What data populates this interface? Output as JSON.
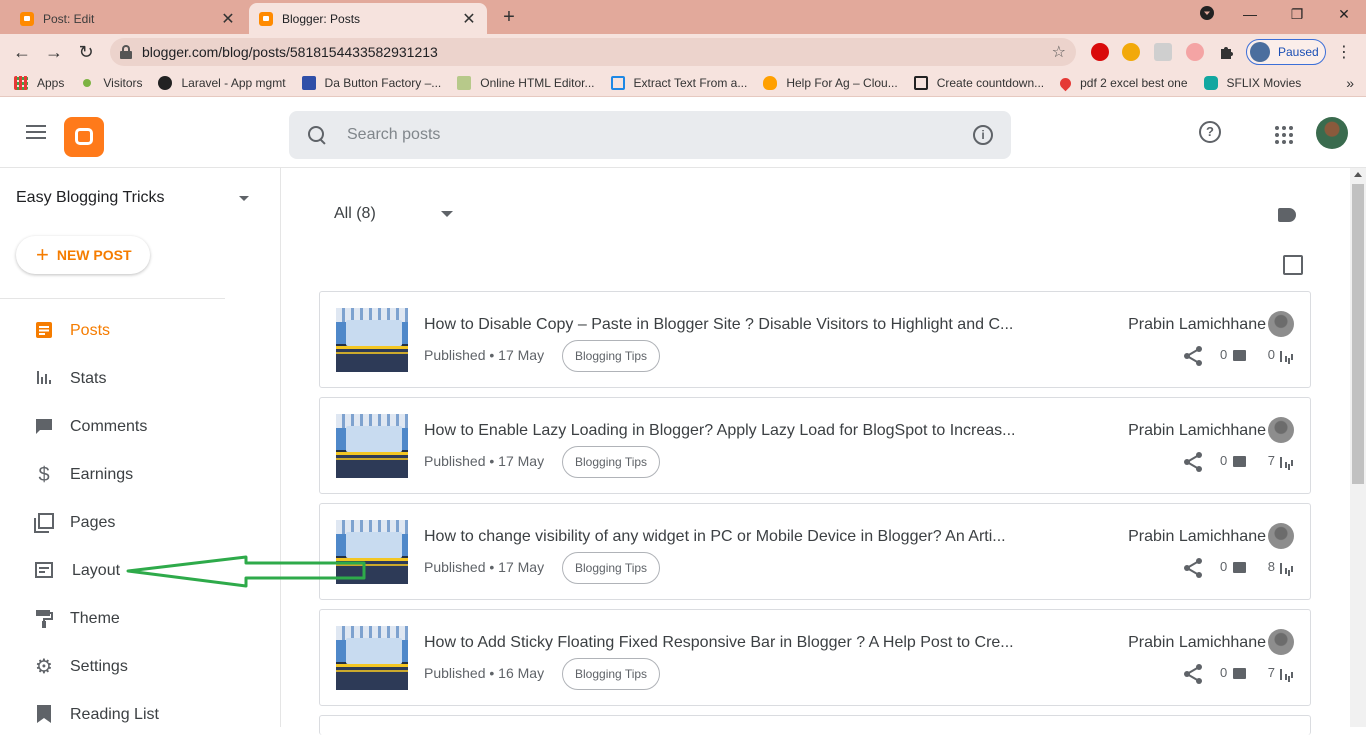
{
  "browser": {
    "tabs": [
      {
        "label": "Post: Edit",
        "active": false
      },
      {
        "label": "Blogger: Posts",
        "active": true
      }
    ],
    "url": "blogger.com/blog/posts/5818154433582931213",
    "profile_status": "Paused",
    "bookmarks": [
      {
        "label": "Apps",
        "icon": "apps-grid-icon"
      },
      {
        "label": "Visitors",
        "icon": "green-dot-icon"
      },
      {
        "label": "Laravel - App mgmt",
        "icon": "globe-icon"
      },
      {
        "label": "Da Button Factory –...",
        "icon": "b-icon"
      },
      {
        "label": "Online HTML Editor...",
        "icon": "code-icon"
      },
      {
        "label": "Extract Text From a...",
        "icon": "b-bracket-icon"
      },
      {
        "label": "Help For Ag – Clou...",
        "icon": "flame-icon"
      },
      {
        "label": "Create countdown...",
        "icon": "terminal-icon"
      },
      {
        "label": "pdf 2 excel best one",
        "icon": "heart-icon"
      },
      {
        "label": "SFLIX Movies",
        "icon": "sflix-icon"
      }
    ],
    "bookmarks_more": "»"
  },
  "blogger": {
    "search_placeholder": "Search posts",
    "blog_name": "Easy Blogging Tricks",
    "new_post_label": "NEW POST",
    "nav": [
      {
        "label": "Posts",
        "icon": "posts-icon",
        "selected": true
      },
      {
        "label": "Stats",
        "icon": "stats-icon"
      },
      {
        "label": "Comments",
        "icon": "comments-icon"
      },
      {
        "label": "Earnings",
        "icon": "dollar-icon"
      },
      {
        "label": "Pages",
        "icon": "pages-icon"
      },
      {
        "label": "Layout",
        "icon": "layout-icon"
      },
      {
        "label": "Theme",
        "icon": "paint-roller-icon"
      },
      {
        "label": "Settings",
        "icon": "gear-icon"
      },
      {
        "label": "Reading List",
        "icon": "bookmark-icon"
      }
    ],
    "filter_label": "All (8)",
    "posts": [
      {
        "title": "How to Disable Copy – Paste in Blogger Site ? Disable Visitors to Highlight and C...",
        "status": "Published • 17 May",
        "label": "Blogging Tips",
        "author": "Prabin Lamichhane",
        "comments": "0",
        "views": "0"
      },
      {
        "title": "How to Enable Lazy Loading in Blogger? Apply Lazy Load for BlogSpot to Increas...",
        "status": "Published • 17 May",
        "label": "Blogging Tips",
        "author": "Prabin Lamichhane",
        "comments": "0",
        "views": "7"
      },
      {
        "title": "How to change visibility of any widget in PC or Mobile Device in Blogger? An Arti...",
        "status": "Published • 17 May",
        "label": "Blogging Tips",
        "author": "Prabin Lamichhane",
        "comments": "0",
        "views": "8"
      },
      {
        "title": "How to Add Sticky Floating Fixed Responsive Bar in Blogger ? A Help Post to Cre...",
        "status": "Published • 16 May",
        "label": "Blogging Tips",
        "author": "Prabin Lamichhane",
        "comments": "0",
        "views": "7"
      }
    ]
  },
  "colors": {
    "accent": "#f57c00",
    "tabstrip": "#e2a99b",
    "annotation_arrow": "#2eaa4a"
  }
}
